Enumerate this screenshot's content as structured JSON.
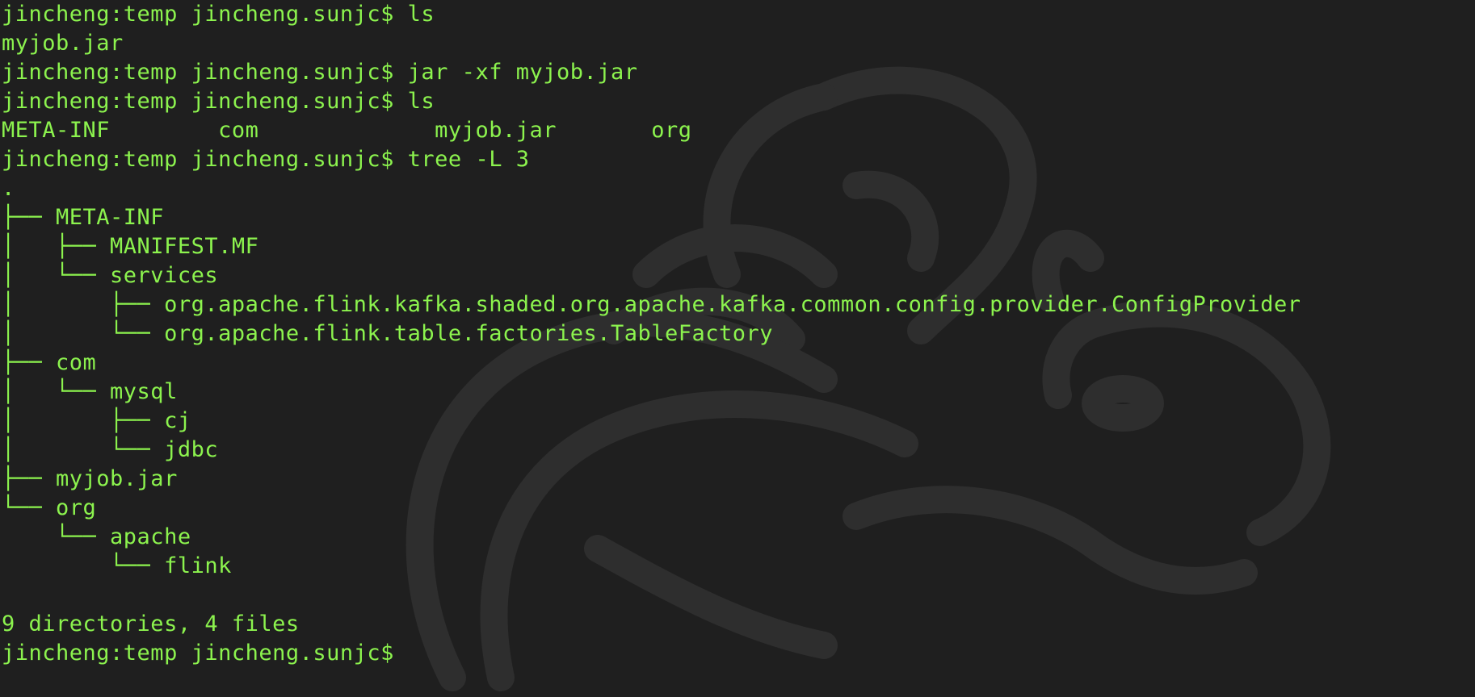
{
  "terminal": {
    "colors": {
      "background": "#1f1f1f",
      "text": "#8cf34e",
      "watermark": "#2e2e2e"
    },
    "watermark_icon": "flink-squirrel-logo",
    "lines": [
      "jincheng:temp jincheng.sunjc$ ls",
      "myjob.jar",
      "jincheng:temp jincheng.sunjc$ jar -xf myjob.jar",
      "jincheng:temp jincheng.sunjc$ ls",
      "META-INF        com             myjob.jar       org",
      "jincheng:temp jincheng.sunjc$ tree -L 3",
      ".",
      "├── META-INF",
      "│   ├── MANIFEST.MF",
      "│   └── services",
      "│       ├── org.apache.flink.kafka.shaded.org.apache.kafka.common.config.provider.ConfigProvider",
      "│       └── org.apache.flink.table.factories.TableFactory",
      "├── com",
      "│   └── mysql",
      "│       ├── cj",
      "│       └── jdbc",
      "├── myjob.jar",
      "└── org",
      "    └── apache",
      "        └── flink",
      "",
      "9 directories, 4 files",
      "jincheng:temp jincheng.sunjc$ "
    ]
  }
}
